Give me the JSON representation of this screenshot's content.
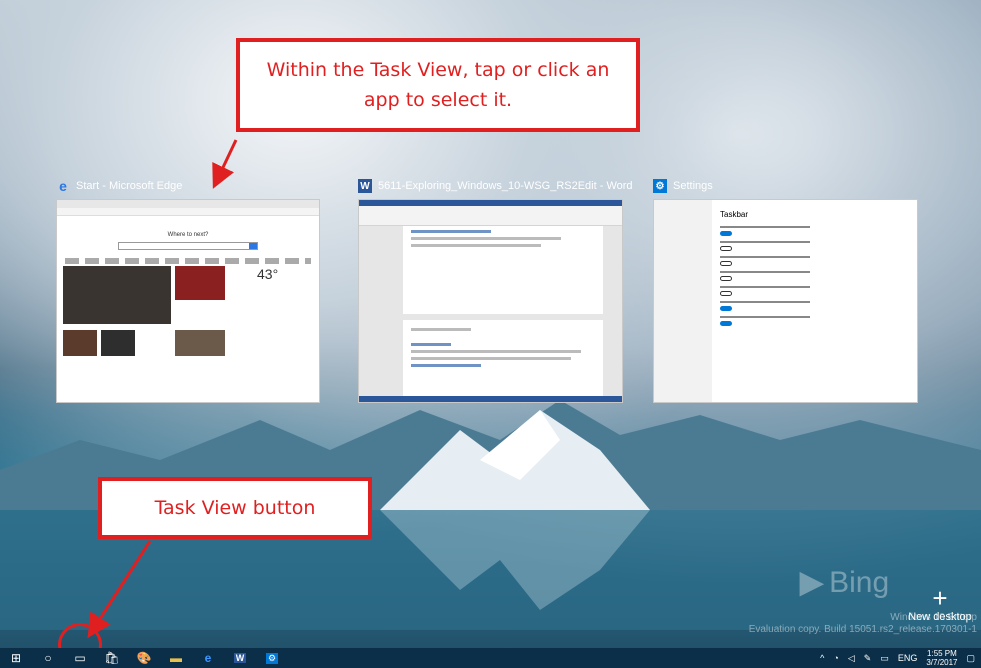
{
  "callouts": {
    "top": "Within the Task View, tap or click an app to select it.",
    "bottom": "Task View button"
  },
  "windows": [
    {
      "title": "Start - Microsoft Edge",
      "icon": "edge-icon",
      "color": "#2b78e4"
    },
    {
      "title": "5611-Exploring_Windows_10-WSG_RS2Edit - Word",
      "icon": "word-icon",
      "color": "#2b579a"
    },
    {
      "title": "Settings",
      "icon": "gear-icon",
      "color": "#0078d7"
    }
  ],
  "edge": {
    "search_heading": "Where to next?",
    "temperature": "43°"
  },
  "settings": {
    "heading": "Taskbar"
  },
  "desktop": {
    "bing": "Bing",
    "new_desktop": "New desktop",
    "watermark_line1": "Windows 10 Enterp",
    "watermark_line2": "Evaluation copy. Build 15051.rs2_release.170301-1"
  },
  "taskbar": {
    "language": "ENG",
    "time": "1:55 PM",
    "date": "3/7/2017",
    "items": [
      "start-icon",
      "cortana-icon",
      "task-view-icon",
      "store-icon",
      "paint-icon",
      "file-explorer-icon",
      "edge-icon",
      "word-icon",
      "settings-icon"
    ]
  },
  "colors": {
    "callout_red": "#e02020",
    "taskbar_bg": "#0b2f48"
  }
}
